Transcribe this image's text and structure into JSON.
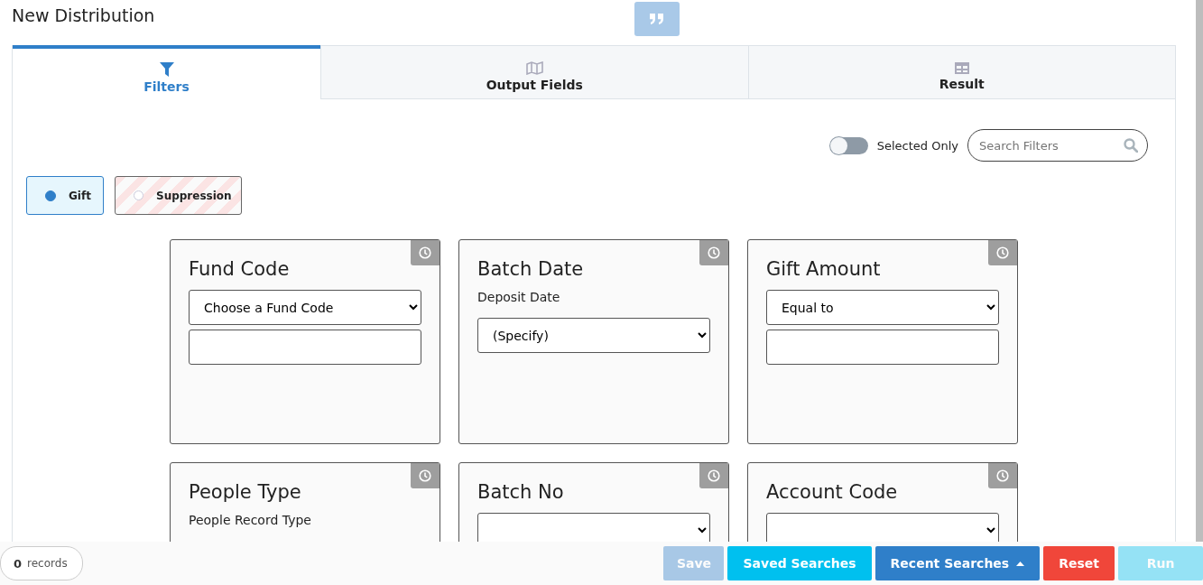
{
  "page": {
    "title": "New Distribution"
  },
  "tabs": [
    {
      "label": "Filters",
      "selected": true
    },
    {
      "label": "Output Fields",
      "selected": false
    },
    {
      "label": "Result",
      "selected": false
    }
  ],
  "toolbar": {
    "selected_only": {
      "label": "Selected Only",
      "on": false
    },
    "search": {
      "placeholder": "Search Filters"
    }
  },
  "record_types": [
    {
      "label": "Gift",
      "selected": true
    },
    {
      "label": "Suppression",
      "selected": false
    }
  ],
  "cards": [
    {
      "title": "Fund Code",
      "fields": [
        {
          "kind": "select",
          "value": "Choose a Fund Code"
        },
        {
          "kind": "input"
        }
      ]
    },
    {
      "title": "Batch Date",
      "subtitle": "Deposit Date",
      "fields": [
        {
          "kind": "select",
          "value": "(Specify)"
        }
      ]
    },
    {
      "title": "Gift Amount",
      "fields": [
        {
          "kind": "select",
          "value": "Equal to"
        },
        {
          "kind": "input"
        }
      ]
    },
    {
      "title": "People Type",
      "subtitle": "People Record Type"
    },
    {
      "title": "Batch No",
      "fields": [
        {
          "kind": "select"
        }
      ]
    },
    {
      "title": "Account Code",
      "fields": [
        {
          "kind": "select"
        }
      ]
    }
  ],
  "footer": {
    "count": "0",
    "count_label": "records",
    "buttons": [
      {
        "label": "Save",
        "kind": "save",
        "disabled": true
      },
      {
        "label": "Saved Searches",
        "kind": "info",
        "disabled": false
      },
      {
        "label": "Recent Searches",
        "kind": "primary",
        "disabled": false,
        "caret": true
      },
      {
        "label": "Reset",
        "kind": "danger",
        "disabled": false
      },
      {
        "label": "Run",
        "kind": "run",
        "disabled": true
      }
    ]
  }
}
